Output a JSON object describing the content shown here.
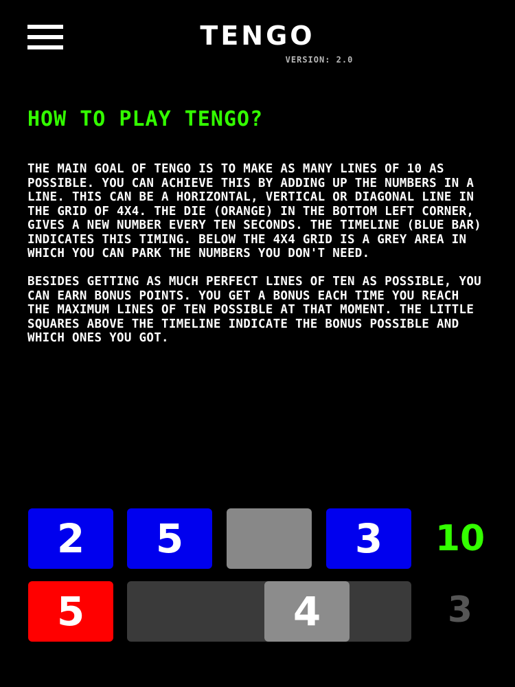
{
  "header": {
    "title": "TENGO",
    "version": "VERSION: 2.0"
  },
  "icons": {
    "menu": "hamburger-menu-icon"
  },
  "content": {
    "heading": "HOW TO PLAY TENGO?",
    "paragraph1": "THE MAIN GOAL OF TENGO IS TO MAKE AS MANY LINES OF 10 AS POSSIBLE. YOU CAN ACHIEVE THIS BY ADDING UP THE NUMBERS IN A LINE. THIS CAN BE A HORIZONTAL, VERTICAL OR DIAGONAL LINE IN THE GRID OF 4X4. THE DIE (ORANGE) IN THE BOTTOM LEFT CORNER, GIVES A NEW NUMBER EVERY TEN SECONDS. THE TIMELINE (BLUE BAR) INDICATES THIS TIMING. BELOW THE 4X4 GRID IS A GREY AREA IN WHICH YOU CAN PARK THE NUMBERS YOU DON'T NEED.",
    "paragraph2": "BESIDES GETTING AS MUCH PERFECT LINES OF TEN AS POSSIBLE, YOU CAN EARN BONUS POINTS. YOU GET A BONUS EACH TIME YOU REACH THE MAXIMUM LINES OF TEN POSSIBLE AT THAT MOMENT. THE LITTLE SQUARES ABOVE THE TIMELINE INDICATE THE BONUS POSSIBLE AND WHICH ONES YOU GOT."
  },
  "demo": {
    "row_tiles": [
      {
        "value": "2",
        "color": "blue"
      },
      {
        "value": "5",
        "color": "blue"
      },
      {
        "value": "",
        "color": "grey"
      },
      {
        "value": "3",
        "color": "blue"
      }
    ],
    "row_sum": "10",
    "die_value": "5",
    "parked_value": "4",
    "next_value": "3"
  },
  "colors": {
    "background": "#000000",
    "heading_green": "#33ff00",
    "tile_blue": "#0000ee",
    "tile_grey": "#888888",
    "die_red": "#ff0000",
    "park_area": "#3a3a3a",
    "muted_number": "#555555"
  }
}
